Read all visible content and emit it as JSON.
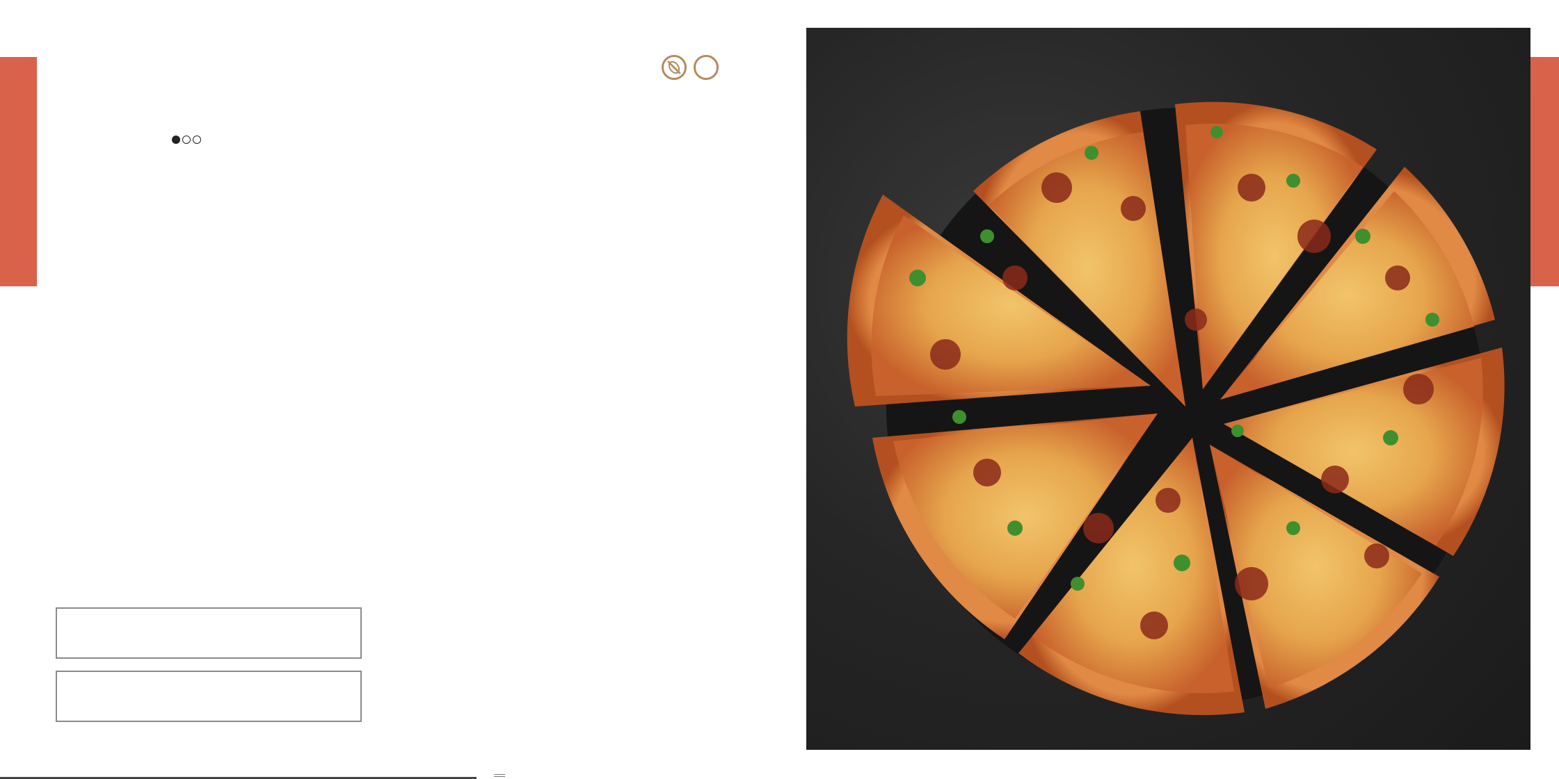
{
  "page": {
    "difficulty": {
      "level": 1,
      "max": 3
    },
    "diet_icons": [
      "nut-free-icon",
      "blank-diet-icon"
    ],
    "accent_color": "#d9624a",
    "icon_ring_color": "#b48a5c",
    "note_boxes": [
      {
        "text": ""
      },
      {
        "text": ""
      }
    ],
    "photo": {
      "subject": "pizza-photo"
    }
  }
}
